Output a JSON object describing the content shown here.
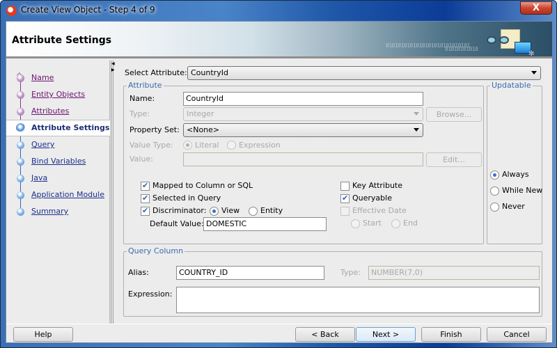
{
  "window": {
    "title": "Create View Object - Step 4 of 9",
    "close_label": "X"
  },
  "header": {
    "title": "Attribute Settings",
    "binary_line1": "0101010101010101010101010101",
    "binary_line2": "01010101010"
  },
  "sidebar": {
    "steps": [
      {
        "label": "Name",
        "state": "visited"
      },
      {
        "label": "Entity Objects",
        "state": "visited"
      },
      {
        "label": "Attributes",
        "state": "visited"
      },
      {
        "label": "Attribute Settings",
        "state": "current"
      },
      {
        "label": "Query",
        "state": "pending"
      },
      {
        "label": "Bind Variables",
        "state": "pending"
      },
      {
        "label": "Java",
        "state": "pending"
      },
      {
        "label": "Application Module",
        "state": "pending"
      },
      {
        "label": "Summary",
        "state": "pending"
      }
    ]
  },
  "form": {
    "select_attribute_label": "Select Attribute:",
    "select_attribute_value": "CountryId",
    "attribute_group": {
      "legend": "Attribute",
      "name_label": "Name:",
      "name_value": "CountryId",
      "type_label": "Type:",
      "type_value": "Integer",
      "browse_label": "Browse...",
      "property_set_label": "Property Set:",
      "property_set_value": "<None>",
      "value_type_label": "Value Type:",
      "value_type_options": [
        {
          "label": "Literal",
          "selected": true
        },
        {
          "label": "Expression",
          "selected": false
        }
      ],
      "value_label": "Value:",
      "value_value": "",
      "edit_label": "Edit...",
      "checkboxes_left": [
        {
          "label": "Mapped to Column or SQL",
          "checked": true,
          "enabled": true
        },
        {
          "label": "Selected in Query",
          "checked": true,
          "enabled": true
        },
        {
          "label": "Discriminator:",
          "checked": true,
          "enabled": true
        }
      ],
      "discriminator_options": [
        {
          "label": "View",
          "selected": true
        },
        {
          "label": "Entity",
          "selected": false
        }
      ],
      "default_value_label": "Default Value:",
      "default_value": "DOMESTIC",
      "checkboxes_right": [
        {
          "label": "Key Attribute",
          "checked": false,
          "enabled": true
        },
        {
          "label": "Queryable",
          "checked": true,
          "enabled": true
        },
        {
          "label": "Effective Date",
          "checked": false,
          "enabled": false
        }
      ],
      "effective_date_options": [
        {
          "label": "Start",
          "selected": false
        },
        {
          "label": "End",
          "selected": false
        }
      ]
    },
    "updatable_group": {
      "legend": "Updatable",
      "options": [
        {
          "label": "Always",
          "selected": true
        },
        {
          "label": "While New",
          "selected": false
        },
        {
          "label": "Never",
          "selected": false
        }
      ]
    },
    "query_column_group": {
      "legend": "Query Column",
      "alias_label": "Alias:",
      "alias_value": "COUNTRY_ID",
      "type_label": "Type:",
      "type_value": "NUMBER(7,0)",
      "expression_label": "Expression:",
      "expression_value": ""
    }
  },
  "footer": {
    "help_label": "Help",
    "back_label": "< Back",
    "next_label": "Next >",
    "finish_label": "Finish",
    "cancel_label": "Cancel"
  }
}
